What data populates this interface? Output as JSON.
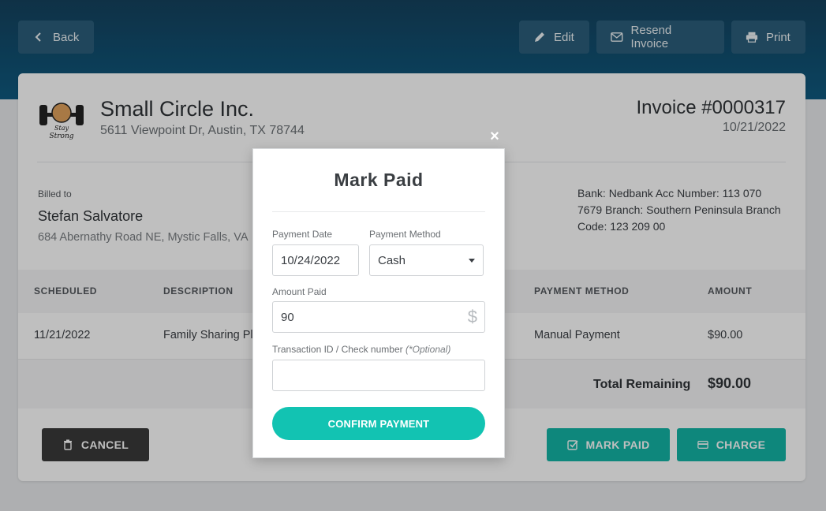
{
  "toolbar": {
    "back_label": "Back",
    "edit_label": "Edit",
    "resend_label": "Resend Invoice",
    "print_label": "Print"
  },
  "company": {
    "name": "Small Circle Inc.",
    "address": "5611 Viewpoint Dr, Austin, TX 78744",
    "logo_text": "Stay Strong"
  },
  "invoice": {
    "number": "Invoice #0000317",
    "date": "10/21/2022"
  },
  "billed_to": {
    "label": "Billed to",
    "name": "Stefan Salvatore",
    "address": "684 Abernathy Road NE, Mystic Falls, VA"
  },
  "bank": {
    "line1": "Bank: Nedbank Acc Number: 113 070",
    "line2": "7679 Branch: Southern Peninsula Branch",
    "line3": "Code: 123 209 00"
  },
  "table": {
    "headers": {
      "scheduled": "SCHEDULED",
      "description": "DESCRIPTION",
      "payment_method": "PAYMENT METHOD",
      "amount": "AMOUNT"
    },
    "row": {
      "scheduled": "11/21/2022",
      "description": "Family Sharing Pl",
      "payment_method": "Manual Payment",
      "amount": "$90.00"
    },
    "total_label": "Total Remaining",
    "total_value": "$90.00"
  },
  "actions": {
    "cancel_label": "CANCEL",
    "mark_paid_label": "MARK PAID",
    "charge_label": "CHARGE"
  },
  "modal": {
    "close_glyph": "×",
    "title": "Mark Paid",
    "payment_date_label": "Payment Date",
    "payment_date_value": "10/24/2022",
    "payment_method_label": "Payment Method",
    "payment_method_value": "Cash",
    "amount_label": "Amount Paid",
    "amount_value": "90",
    "currency_symbol": "$",
    "txn_label": "Transaction ID / Check number",
    "txn_optional": "(*Optional)",
    "txn_value": "",
    "confirm_label": "CONFIRM PAYMENT"
  },
  "colors": {
    "header_dark": "#14425e",
    "accent_teal": "#13b5a6",
    "confirm_teal": "#12c3b2",
    "cancel_dark": "#3a3a3a"
  }
}
